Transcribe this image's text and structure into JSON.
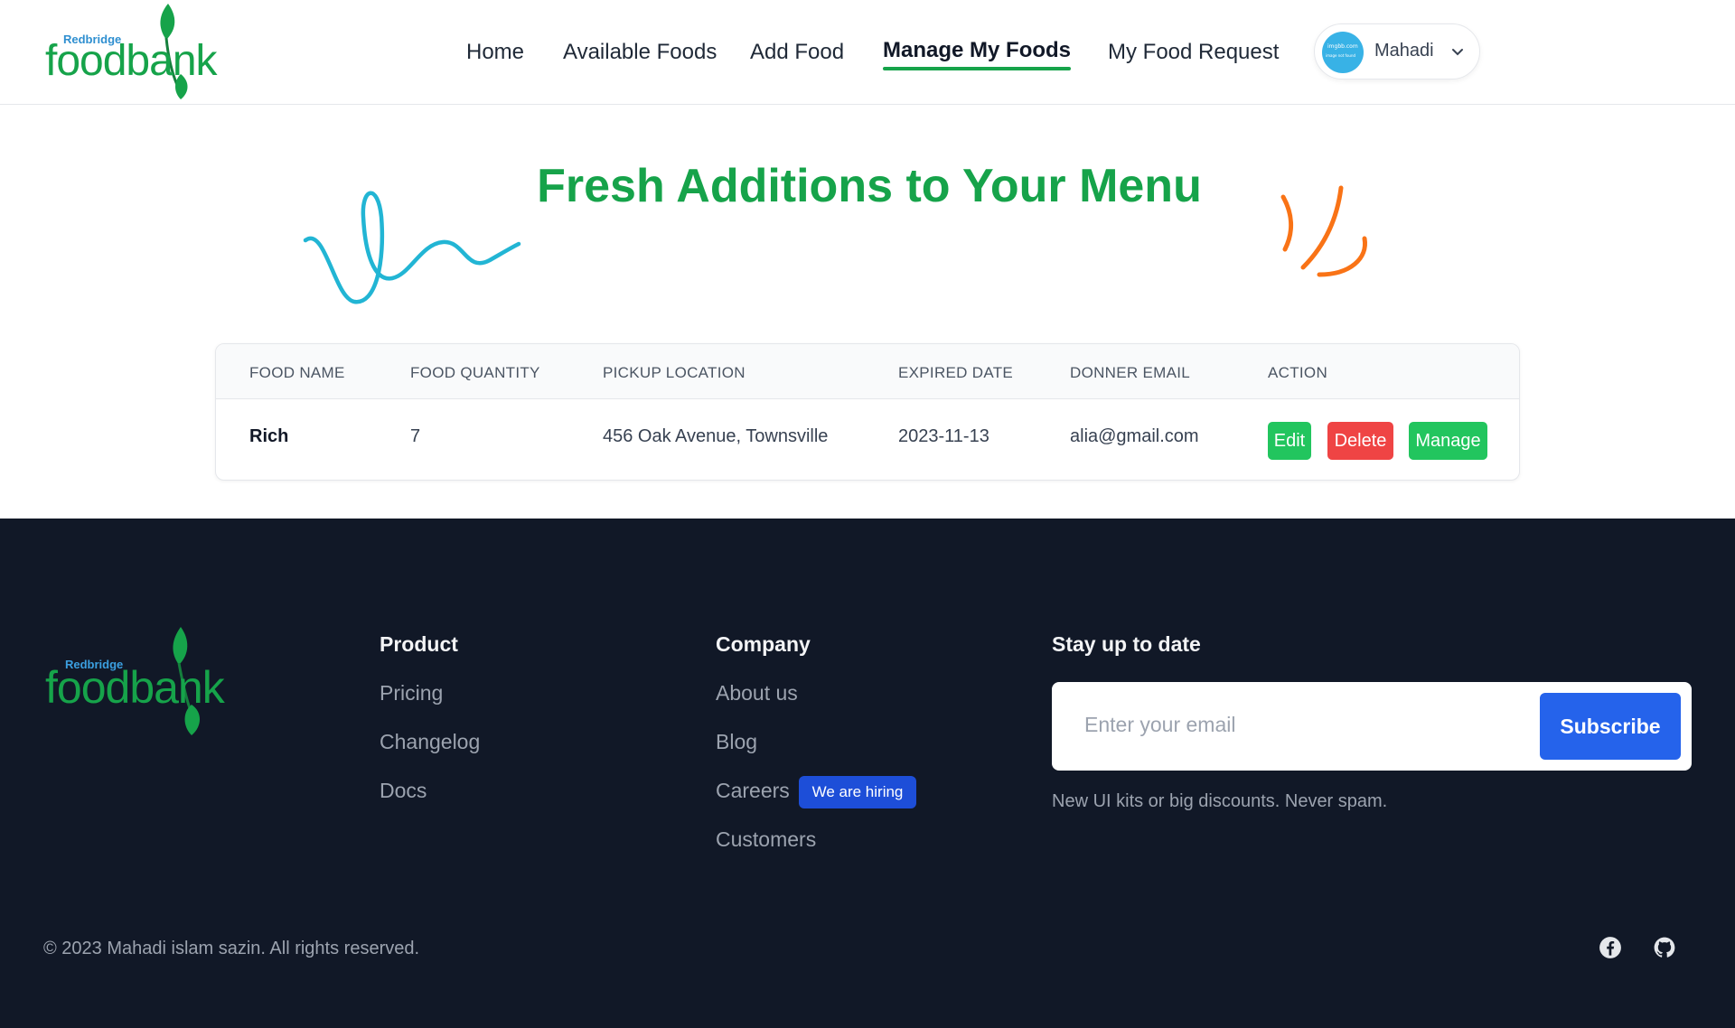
{
  "brand": {
    "small": "Redbridge",
    "word": "foodbank"
  },
  "nav": {
    "links": [
      {
        "label": "Home"
      },
      {
        "label": "Available Foods"
      },
      {
        "label": "Add Food"
      },
      {
        "label": "Manage My Foods",
        "active": true
      },
      {
        "label": "My Food Request"
      }
    ],
    "user": {
      "name": "Mahadi",
      "avatar_text1": "imgbb.com",
      "avatar_text2": "image not found"
    }
  },
  "hero": {
    "title": "Fresh Additions to Your Menu"
  },
  "table": {
    "headers": [
      "FOOD NAME",
      "FOOD QUANTITY",
      "PICKUP LOCATION",
      "EXPIRED DATE",
      "DONNER EMAIL",
      "ACTION"
    ],
    "rows": [
      {
        "food_name": "Rich",
        "quantity": "7",
        "location": "456 Oak Avenue, Townsville",
        "expired": "2023-11-13",
        "email": "alia@gmail.com"
      }
    ],
    "actions": {
      "edit": "Edit",
      "delete": "Delete",
      "manage": "Manage"
    }
  },
  "footer": {
    "product": {
      "heading": "Product",
      "links": [
        "Pricing",
        "Changelog",
        "Docs"
      ]
    },
    "company": {
      "heading": "Company",
      "links": [
        "About us",
        "Blog",
        "Careers",
        "Customers"
      ],
      "badge": "We are hiring"
    },
    "newsletter": {
      "heading": "Stay up to date",
      "placeholder": "Enter your email",
      "button": "Subscribe",
      "note": "New UI kits or big discounts. Never spam."
    },
    "copyright": "© 2023 Mahadi islam sazin. All rights reserved.",
    "social_icons": [
      "facebook-icon",
      "github-icon"
    ]
  },
  "colors": {
    "brand_green": "#16a34a",
    "accent_blue": "#2563eb",
    "delete_red": "#ef4444",
    "footer_bg": "#111827"
  }
}
